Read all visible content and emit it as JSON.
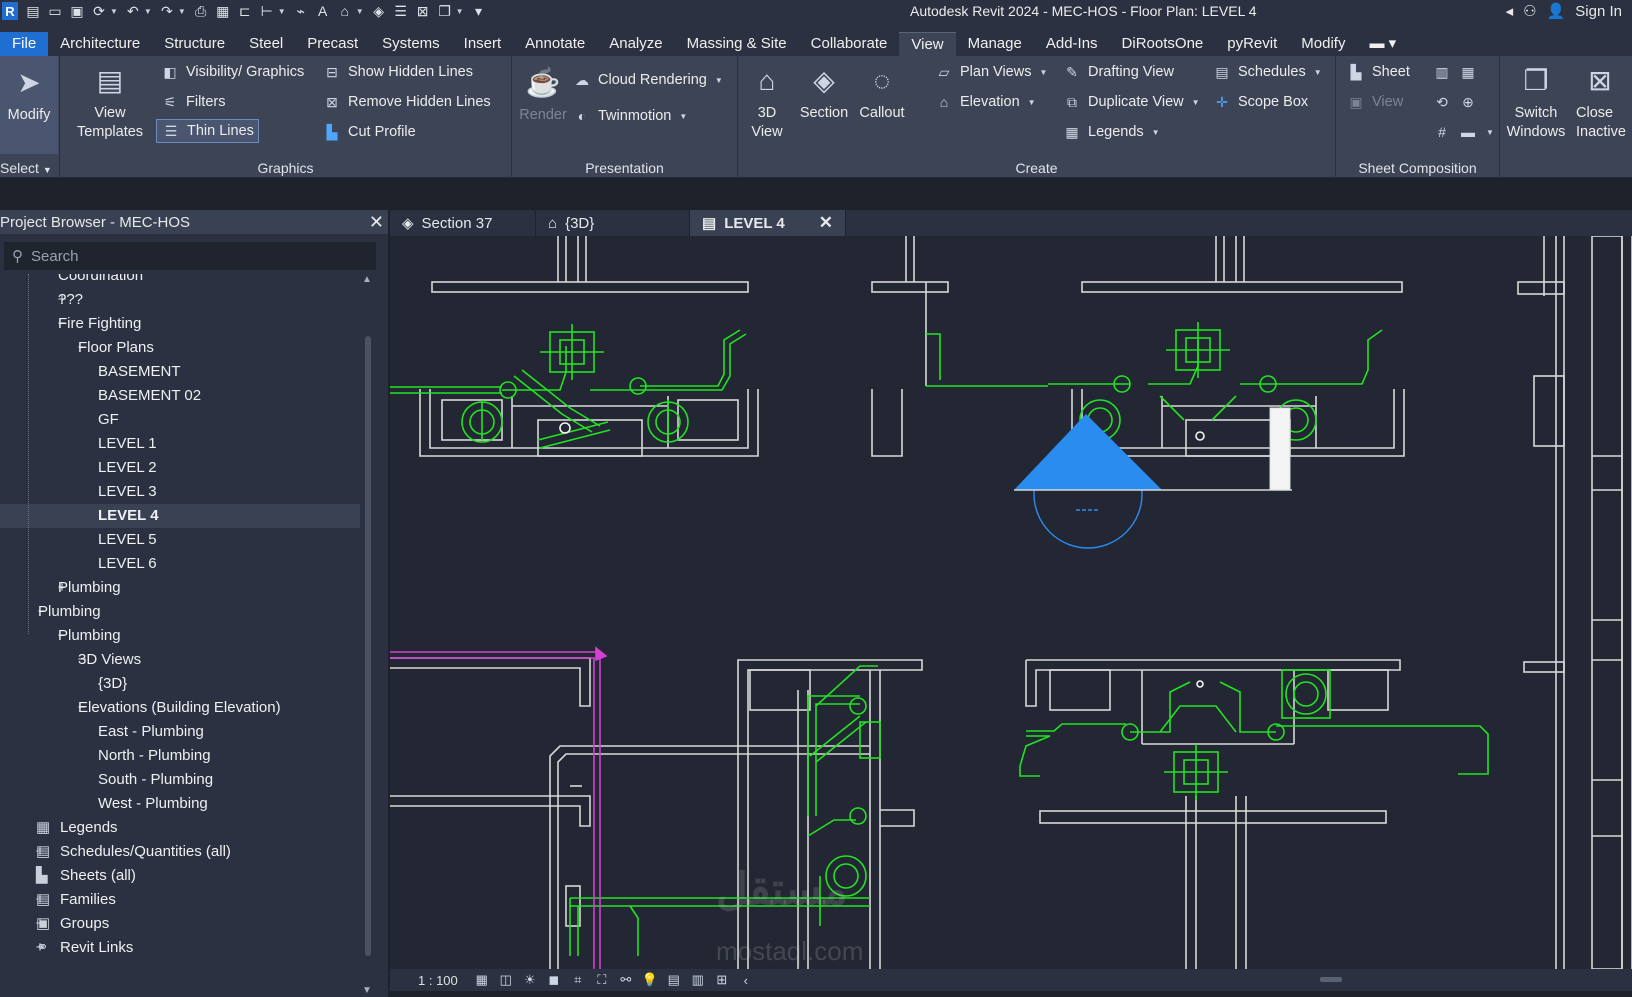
{
  "title_bar": {
    "app_title": "Autodesk Revit 2024 - MEC-HOS - Floor Plan: LEVEL 4",
    "sign_in": "Sign In",
    "qat_icons": [
      "revit-logo-icon",
      "info-icon",
      "open-icon",
      "save-icon",
      "sync-icon",
      "undo-icon",
      "redo-icon",
      "print-icon",
      "annotate-icon",
      "measure-icon",
      "dimension-icon",
      "tag-icon",
      "text-icon",
      "home-icon",
      "section-view-icon",
      "thin-lines-icon",
      "close-hidden-icon",
      "switch-windows-icon",
      "customize-icon"
    ]
  },
  "menu": {
    "tabs": [
      "File",
      "Architecture",
      "Structure",
      "Steel",
      "Precast",
      "Systems",
      "Insert",
      "Annotate",
      "Analyze",
      "Massing & Site",
      "Collaborate",
      "View",
      "Manage",
      "Add-Ins",
      "DiRootsOne",
      "pyRevit",
      "Modify"
    ],
    "active": "View"
  },
  "ribbon": {
    "select": {
      "modify": "Modify",
      "select": "Select"
    },
    "graphics": {
      "title": "Graphics",
      "view_templates": "View Templates",
      "visibility_graphics": "Visibility/ Graphics",
      "filters": "Filters",
      "thin_lines": "Thin Lines",
      "show_hidden_lines": "Show Hidden Lines",
      "remove_hidden_lines": "Remove Hidden Lines",
      "cut_profile": "Cut Profile"
    },
    "presentation": {
      "title": "Presentation",
      "render": "Render",
      "cloud_rendering": "Cloud Rendering",
      "twinmotion": "Twinmotion"
    },
    "create": {
      "title": "Create",
      "view_3d": "3D View",
      "section": "Section",
      "callout": "Callout",
      "plan_views": "Plan Views",
      "elevation": "Elevation",
      "drafting_view": "Drafting View",
      "duplicate_view": "Duplicate View",
      "legends": "Legends",
      "schedules": "Schedules",
      "scope_box": "Scope Box"
    },
    "sheet_composition": {
      "title": "Sheet Composition",
      "sheet": "Sheet",
      "view": "View"
    },
    "windows": {
      "switch_windows": "Switch Windows",
      "close_inactive": "Close Inactive"
    }
  },
  "browser": {
    "title": "Project Browser - MEC-HOS",
    "search_placeholder": "Search",
    "items": [
      {
        "label": "Coordination",
        "toggle": ""
      },
      {
        "label": "???",
        "toggle": "+"
      },
      {
        "label": "Fire Fighting",
        "toggle": "−"
      },
      {
        "label": "Floor Plans",
        "toggle": "−"
      },
      {
        "label": "BASEMENT",
        "toggle": ""
      },
      {
        "label": "BASEMENT 02",
        "toggle": ""
      },
      {
        "label": "GF",
        "toggle": ""
      },
      {
        "label": "LEVEL 1",
        "toggle": ""
      },
      {
        "label": "LEVEL 2",
        "toggle": ""
      },
      {
        "label": "LEVEL 3",
        "toggle": ""
      },
      {
        "label": "LEVEL 4",
        "toggle": ""
      },
      {
        "label": "LEVEL 5",
        "toggle": ""
      },
      {
        "label": "LEVEL 6",
        "toggle": ""
      },
      {
        "label": "Plumbing",
        "toggle": "+"
      },
      {
        "label": "Plumbing",
        "toggle": "−"
      },
      {
        "label": "Plumbing",
        "toggle": "−"
      },
      {
        "label": "3D Views",
        "toggle": "−"
      },
      {
        "label": "{3D}",
        "toggle": ""
      },
      {
        "label": "Elevations (Building Elevation)",
        "toggle": "−"
      },
      {
        "label": "East - Plumbing",
        "toggle": ""
      },
      {
        "label": "North - Plumbing",
        "toggle": ""
      },
      {
        "label": "South - Plumbing",
        "toggle": ""
      },
      {
        "label": "West - Plumbing",
        "toggle": ""
      },
      {
        "label": "Legends",
        "toggle": ""
      },
      {
        "label": "Schedules/Quantities (all)",
        "toggle": "+"
      },
      {
        "label": "Sheets (all)",
        "toggle": ""
      },
      {
        "label": "Families",
        "toggle": "+"
      },
      {
        "label": "Groups",
        "toggle": "+"
      },
      {
        "label": "Revit Links",
        "toggle": "+"
      }
    ],
    "selected": "LEVEL 4"
  },
  "doc_tabs": [
    {
      "label": "Section 37",
      "icon": "section-view-icon"
    },
    {
      "label": "{3D}",
      "icon": "home-icon"
    },
    {
      "label": "LEVEL 4",
      "icon": "floor-plan-icon"
    }
  ],
  "view_bar": {
    "scale": "1 : 100"
  },
  "colors": {
    "accent": "#1e6fd1",
    "pipe_green": "#22e322",
    "wall_white": "#d8d8d8",
    "section_blue": "#2b8cf0",
    "magenta": "#d440d4"
  },
  "watermark": {
    "arabic": "مستقل",
    "latin": "mostaql.com"
  }
}
